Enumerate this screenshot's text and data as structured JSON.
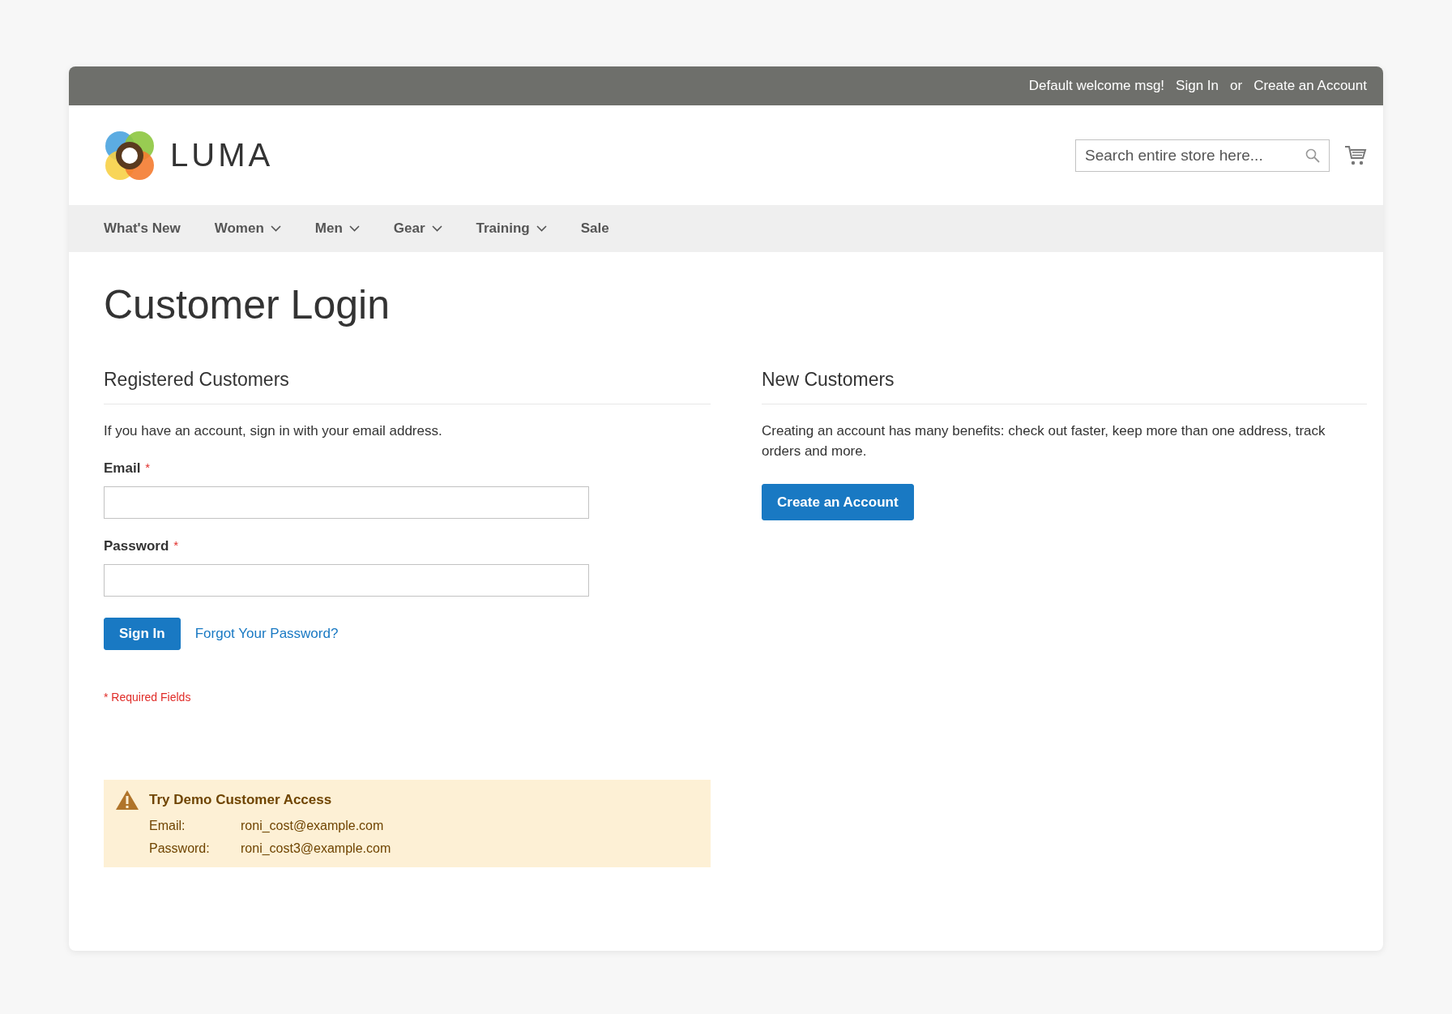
{
  "top_bar": {
    "welcome": "Default welcome msg!",
    "links": [
      "Sign In",
      "Create an Account"
    ],
    "separator": "or"
  },
  "header": {
    "logo_text": "LUMA",
    "search": {
      "placeholder": "Search entire store here..."
    }
  },
  "nav": [
    {
      "label": "What's New",
      "has_dropdown": false
    },
    {
      "label": "Women",
      "has_dropdown": true
    },
    {
      "label": "Men",
      "has_dropdown": true
    },
    {
      "label": "Gear",
      "has_dropdown": true
    },
    {
      "label": "Training",
      "has_dropdown": true
    },
    {
      "label": "Sale",
      "has_dropdown": false
    }
  ],
  "page_title": "Customer Login",
  "registered": {
    "heading": "Registered Customers",
    "intro": "If you have an account, sign in with your email address.",
    "fields": [
      {
        "label": "Email",
        "required_mark": "*"
      },
      {
        "label": "Password",
        "required_mark": "*"
      }
    ],
    "sign_in": "Sign In",
    "forgot_link": "Forgot Your Password?",
    "required_note": "* Required Fields"
  },
  "new_customers": {
    "heading": "New Customers",
    "text": "Creating an account has many benefits: check out faster, keep more than one address, track orders and more.",
    "button": "Create an Account"
  },
  "demo": {
    "title": "Try Demo Customer Access",
    "rows": [
      {
        "label": "Email:",
        "value": "roni_cost@example.com"
      },
      {
        "label": "Password:",
        "value": "roni_cost3@example.com"
      }
    ]
  }
}
